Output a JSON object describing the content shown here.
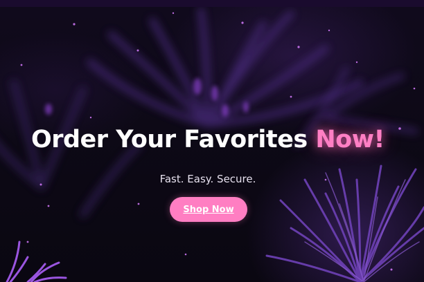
{
  "hero": {
    "headline": "Order Your Favorites",
    "headline_accent": "Now!",
    "tagline": "Fast. Easy. Secure.",
    "cta_label": "Shop Now"
  },
  "colors": {
    "background": "#0b0812",
    "top_bar": "#1a0b2e",
    "accent": "#ff7fc4",
    "button": "#ff7ec2",
    "foliage": "#6a3fb0"
  }
}
